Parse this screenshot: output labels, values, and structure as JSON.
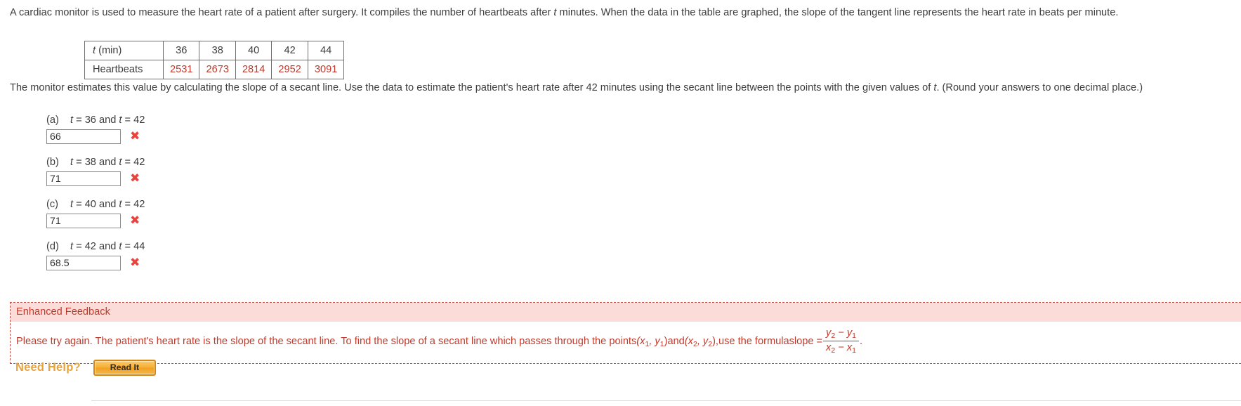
{
  "problem": {
    "intro_part1": "A cardiac monitor is used to measure the heart rate of a patient after surgery. It compiles the number of heartbeats after ",
    "intro_var": "t",
    "intro_part2": " minutes. When the data in the table are graphed, the slope of the tangent line represents the heart rate in beats per minute.",
    "instruction_part1": "The monitor estimates this value by calculating the slope of a secant line. Use the data to estimate the patient's heart rate after 42 minutes using the secant line between the points with the given values of ",
    "instruction_var": "t",
    "instruction_part2": ". (Round your answers to one decimal place.)"
  },
  "table": {
    "row1_header": "t (min)",
    "row1_header_var": "t",
    "row1_header_rest": " (min)",
    "row2_header": "Heartbeats",
    "t_values": [
      "36",
      "38",
      "40",
      "42",
      "44"
    ],
    "heartbeat_values": [
      "2531",
      "2673",
      "2814",
      "2952",
      "3091"
    ],
    "value_color": "#c0392b"
  },
  "parts": [
    {
      "letter": "(a)",
      "condition_prefix": "t",
      "condition": " = 36 and ",
      "condition_var2": "t",
      "condition_suffix": " = 42",
      "answer": "66",
      "status_icon": "x-mark-incorrect",
      "status": "incorrect"
    },
    {
      "letter": "(b)",
      "condition_prefix": "t",
      "condition": " = 38 and ",
      "condition_var2": "t",
      "condition_suffix": " = 42",
      "answer": "71",
      "status_icon": "x-mark-incorrect",
      "status": "incorrect"
    },
    {
      "letter": "(c)",
      "condition_prefix": "t",
      "condition": " = 40 and ",
      "condition_var2": "t",
      "condition_suffix": " = 42",
      "answer": "71",
      "status_icon": "x-mark-incorrect",
      "status": "incorrect"
    },
    {
      "letter": "(d)",
      "condition_prefix": "t",
      "condition": " = 42 and ",
      "condition_var2": "t",
      "condition_suffix": " = 44",
      "answer": "68.5",
      "status_icon": "x-mark-incorrect",
      "status": "incorrect"
    }
  ],
  "feedback": {
    "title": "Enhanced Feedback",
    "text_1": "Please try again. The patient's heart rate is the slope of the secant line. To find the slope of a secant line which passes through the points ",
    "point1": "(x",
    "point1_sub1": "1",
    "point1_mid": ", y",
    "point1_sub2": "1",
    "point1_end": ")",
    "text_and": " and ",
    "point2": "(x",
    "point2_sub1": "2",
    "point2_mid": ", y",
    "point2_sub2": "2",
    "point2_end": "),",
    "text_2": " use the formula ",
    "formula_label": "slope = ",
    "numerator_y2": "y",
    "numerator_sub2": "2",
    "numerator_minus": " − y",
    "numerator_sub1": "1",
    "denominator_x2": "x",
    "denominator_sub2": "2",
    "denominator_minus": " − x",
    "denominator_sub1": "1",
    "period": ".",
    "accent_color": "#c0392b",
    "header_bg": "#fbdcd8"
  },
  "help": {
    "label": "Need Help?",
    "button_label": "Read It",
    "label_color": "#e8a33d"
  }
}
